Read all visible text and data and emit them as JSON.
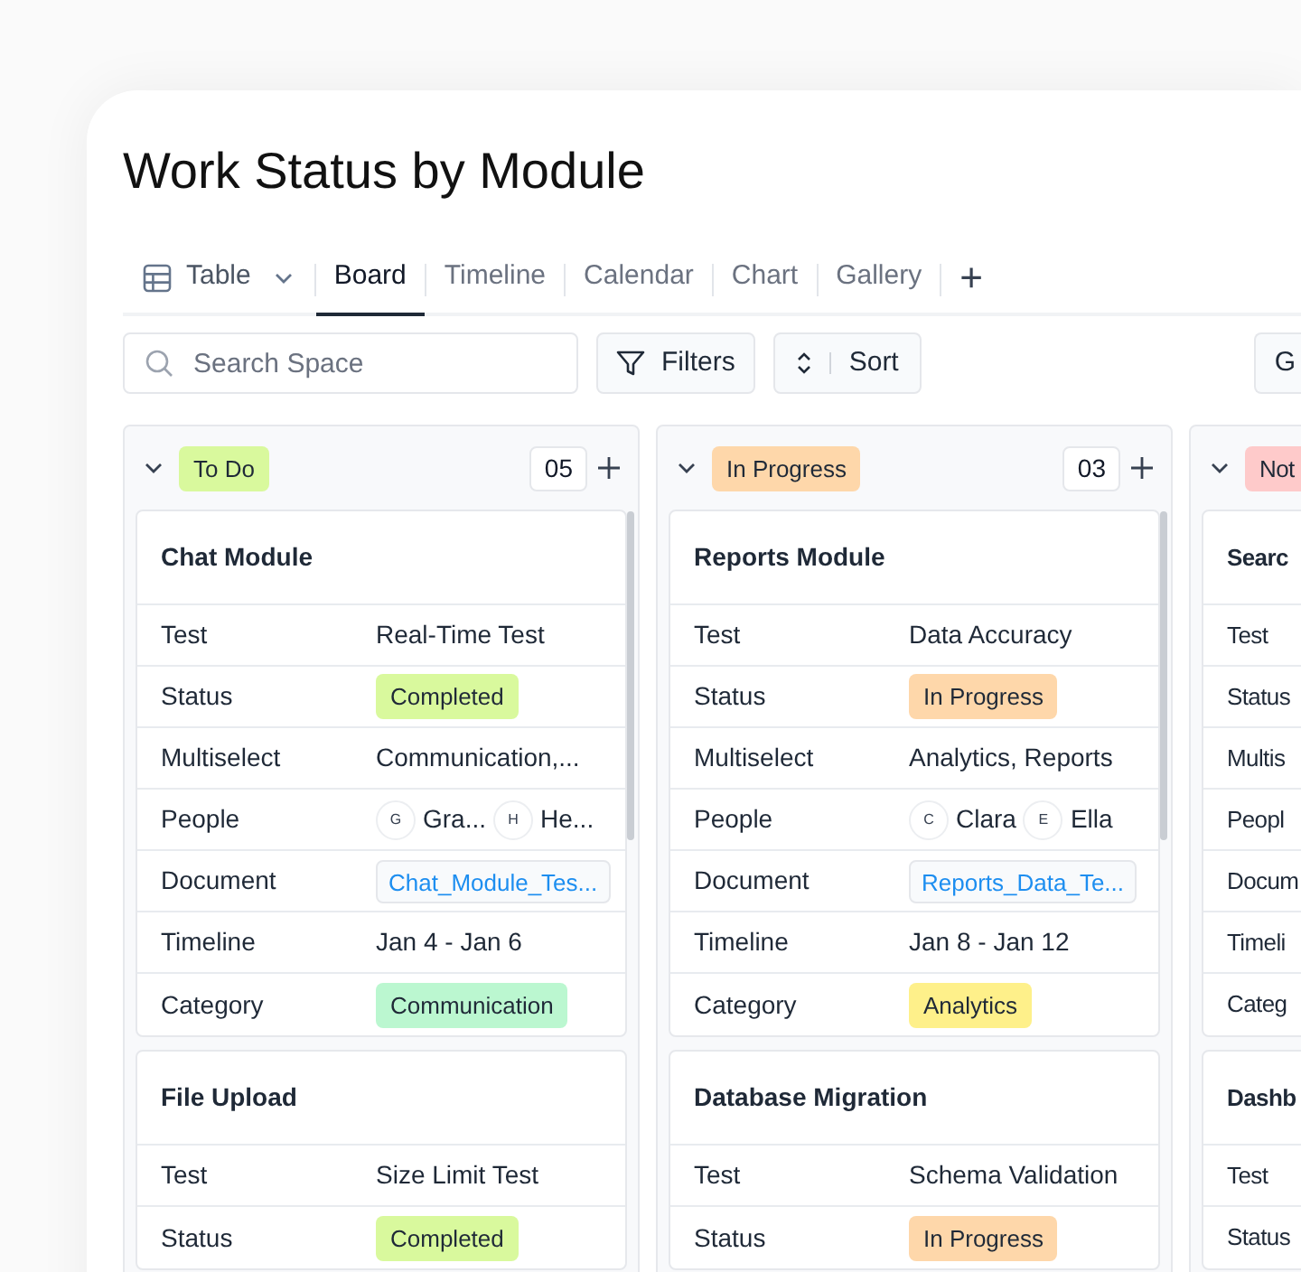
{
  "title": "Work Status by Module",
  "tabs": [
    {
      "label": "Table",
      "kind": "dropdown",
      "selected": false
    },
    {
      "label": "Board",
      "kind": "tab",
      "selected": true
    },
    {
      "label": "Timeline",
      "kind": "tab",
      "selected": false
    },
    {
      "label": "Calendar",
      "kind": "tab",
      "selected": false
    },
    {
      "label": "Chart",
      "kind": "tab",
      "selected": false
    },
    {
      "label": "Gallery",
      "kind": "tab",
      "selected": false
    },
    {
      "label": "+",
      "kind": "add",
      "selected": false
    }
  ],
  "toolbar": {
    "search": {
      "placeholder": "Search Space"
    },
    "buttons": [
      {
        "label": "Filters",
        "kind": "filter"
      },
      {
        "label": "Sort",
        "kind": "sort"
      },
      {
        "label": "G",
        "kind": "plain"
      }
    ]
  },
  "columns": [
    {
      "label": "To Do",
      "color": "#d9f99d",
      "count": "05",
      "cards": [
        {
          "title": "Chat Module",
          "fields": [
            {
              "label": "Test",
              "kind": "text",
              "value": "Real-Time Test"
            },
            {
              "label": "Status",
              "kind": "badge",
              "value": "Completed",
              "color": "#d9f99d"
            },
            {
              "label": "Multiselect",
              "kind": "text",
              "value": "Communication,..."
            },
            {
              "label": "People",
              "kind": "people",
              "people": [
                {
                  "initial": "G",
                  "name": "Gra..."
                },
                {
                  "initial": "H",
                  "name": "He..."
                }
              ]
            },
            {
              "label": "Document",
              "kind": "document",
              "value": "Chat_Module_Tes..."
            },
            {
              "label": "Timeline",
              "kind": "text",
              "value": "Jan 4 - Jan 6"
            },
            {
              "label": "Category",
              "kind": "badge",
              "value": "Communication",
              "color": "#bbf7d0"
            }
          ]
        },
        {
          "title": "File Upload",
          "fields": [
            {
              "label": "Test",
              "kind": "text",
              "value": "Size Limit Test"
            },
            {
              "label": "Status",
              "kind": "badge",
              "value": "Completed",
              "color": "#d9f99d"
            }
          ]
        }
      ]
    },
    {
      "label": "In Progress",
      "color": "#fed7aa",
      "count": "03",
      "cards": [
        {
          "title": "Reports Module",
          "fields": [
            {
              "label": "Test",
              "kind": "text",
              "value": "Data Accuracy"
            },
            {
              "label": "Status",
              "kind": "badge",
              "value": "In Progress",
              "color": "#fed7aa"
            },
            {
              "label": "Multiselect",
              "kind": "text",
              "value": "Analytics, Reports"
            },
            {
              "label": "People",
              "kind": "people",
              "people": [
                {
                  "initial": "C",
                  "name": "Clara"
                },
                {
                  "initial": "E",
                  "name": "Ella"
                }
              ]
            },
            {
              "label": "Document",
              "kind": "document",
              "value": "Reports_Data_Te..."
            },
            {
              "label": "Timeline",
              "kind": "text",
              "value": "Jan 8 - Jan 12"
            },
            {
              "label": "Category",
              "kind": "badge",
              "value": "Analytics",
              "color": "#fef08a"
            }
          ]
        },
        {
          "title": "Database Migration",
          "fields": [
            {
              "label": "Test",
              "kind": "text",
              "value": "Schema Validation"
            },
            {
              "label": "Status",
              "kind": "badge",
              "value": "In Progress",
              "color": "#fed7aa"
            }
          ]
        }
      ]
    },
    {
      "label": "Not",
      "color": "#fecaca",
      "cards": [
        {
          "title": "Searc",
          "fields": [
            {
              "label": "Test"
            },
            {
              "label": "Status"
            },
            {
              "label": "Multis"
            },
            {
              "label": "Peopl"
            },
            {
              "label": "Docum"
            },
            {
              "label": "Timeli"
            },
            {
              "label": "Categ"
            }
          ]
        },
        {
          "title": "Dashb",
          "fields": [
            {
              "label": "Test"
            },
            {
              "label": "Status"
            }
          ]
        }
      ]
    }
  ]
}
